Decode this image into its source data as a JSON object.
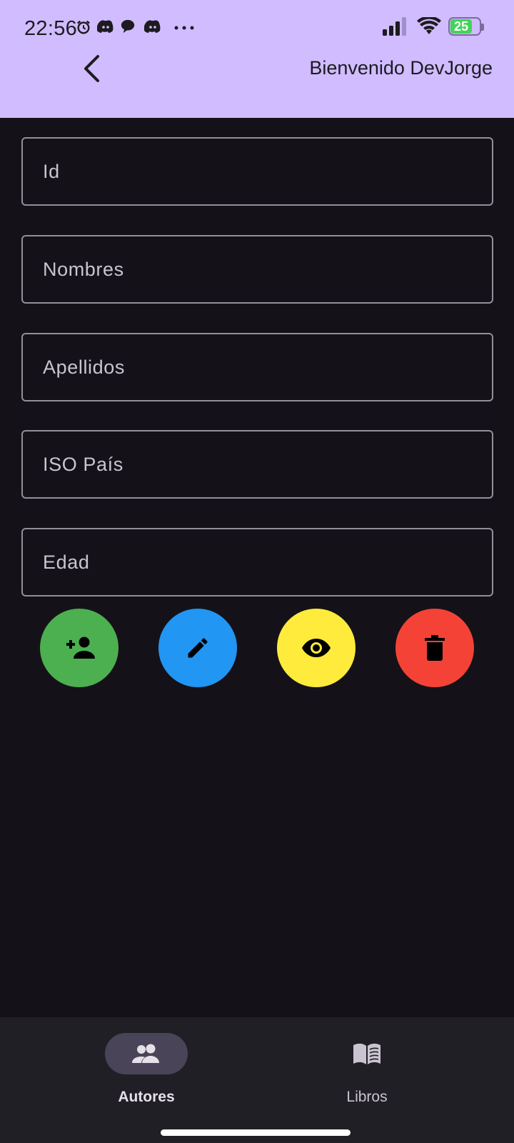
{
  "status_bar": {
    "time": "22:56",
    "battery": "25"
  },
  "app_bar": {
    "title": "Bienvenido DevJorge"
  },
  "form": {
    "fields": [
      {
        "placeholder": "Id",
        "value": ""
      },
      {
        "placeholder": "Nombres",
        "value": ""
      },
      {
        "placeholder": "Apellidos",
        "value": ""
      },
      {
        "placeholder": "ISO País",
        "value": ""
      },
      {
        "placeholder": "Edad",
        "value": ""
      }
    ]
  },
  "actions": [
    {
      "icon": "add-person-icon",
      "color": "#4caf50"
    },
    {
      "icon": "edit-pencil-icon",
      "color": "#2196f3"
    },
    {
      "icon": "eye-icon",
      "color": "#ffeb3b"
    },
    {
      "icon": "delete-icon",
      "color": "#f44336"
    }
  ],
  "bottom_nav": {
    "items": [
      {
        "label": "Autores",
        "icon": "people-icon",
        "active": true
      },
      {
        "label": "Libros",
        "icon": "book-icon",
        "active": false
      }
    ]
  },
  "colors": {
    "app_bar": "#d0bcff",
    "background": "#141218",
    "nav_background": "#211f26",
    "nav_indicator": "#4a4458"
  }
}
